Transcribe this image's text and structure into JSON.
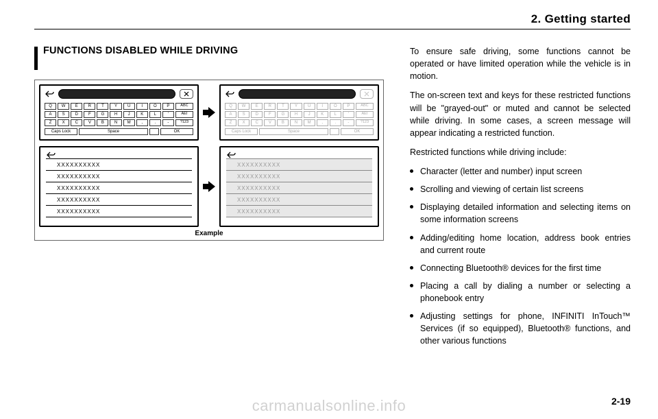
{
  "chapter": "2. Getting started",
  "heading": "FUNCTIONS DISABLED WHILE DRIVING",
  "example_label": "Example",
  "keyboard": {
    "row1": [
      "Q",
      "W",
      "E",
      "R",
      "T",
      "Y",
      "U",
      "I",
      "O",
      "P"
    ],
    "row2": [
      "A",
      "S",
      "D",
      "F",
      "G",
      "H",
      "J",
      "K",
      "L",
      "’"
    ],
    "row3": [
      "Z",
      "X",
      "C",
      "V",
      "B",
      "N",
      "M",
      ",",
      ".",
      "-"
    ],
    "mode1": "ABC",
    "mode2": "ÄÈÎ",
    "mode3": "?123",
    "caps": "Caps Lock",
    "space": "Space",
    "ok": "OK"
  },
  "list_placeholder": "XXXXXXXXXX",
  "paras": {
    "p1": "To ensure safe driving, some functions cannot be operated or have limited opera­tion while the vehicle is in motion.",
    "p2": "The on-screen text and keys for these restricted functions will be \"grayed-out\" or muted and cannot be selected while driving. In some cases, a screen message will appear indicating a restricted function.",
    "p3": "Restricted functions while driving include:"
  },
  "bullets": [
    "Character (letter and number) input screen",
    "Scrolling and viewing of certain list screens",
    "Displaying detailed information and se­lecting items on some information screens",
    "Adding/editing home location, address book entries and current route",
    "Connecting Bluetooth® devices for the first time",
    "Placing a call by dialing a number or selecting a phonebook entry",
    "Adjusting settings for phone, INFINITI InTouch™ Services (if so equipped), Bluetooth® functions, and other various functions"
  ],
  "pagenum": "2-19",
  "watermark": "carmanualsonline.info"
}
